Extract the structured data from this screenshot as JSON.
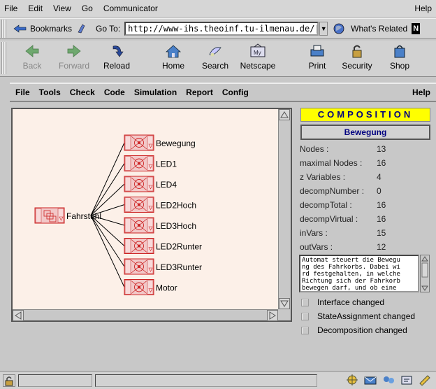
{
  "browser": {
    "menu": [
      "File",
      "Edit",
      "View",
      "Go",
      "Communicator"
    ],
    "help": "Help",
    "bookmarks": "Bookmarks",
    "goto_label": "Go To:",
    "url": "http://www-ihs.theoinf.tu-ilmenau.de/|",
    "whats_related": "What's Related",
    "nav": [
      {
        "label": "Back",
        "icon": "back-arrow-icon",
        "enabled": false
      },
      {
        "label": "Forward",
        "icon": "forward-arrow-icon",
        "enabled": false
      },
      {
        "label": "Reload",
        "icon": "reload-icon",
        "enabled": true
      },
      {
        "label": "Home",
        "icon": "home-icon",
        "enabled": true
      },
      {
        "label": "Search",
        "icon": "search-icon",
        "enabled": true
      },
      {
        "label": "Netscape",
        "icon": "netscape-icon",
        "enabled": true
      },
      {
        "label": "Print",
        "icon": "print-icon",
        "enabled": true
      },
      {
        "label": "Security",
        "icon": "security-lock-icon",
        "enabled": true
      },
      {
        "label": "Shop",
        "icon": "shop-icon",
        "enabled": true
      }
    ]
  },
  "applet": {
    "menu": [
      "File",
      "Tools",
      "Check",
      "Code",
      "Simulation",
      "Report",
      "Config"
    ],
    "help": "Help",
    "diagram": {
      "root": "Fahrstuhl",
      "children": [
        "Bewegung",
        "LED1",
        "LED4",
        "LED2Hoch",
        "LED3Hoch",
        "LED2Runter",
        "LED3Runter",
        "Motor"
      ]
    },
    "panel": {
      "header": "COMPOSITION",
      "selected": "Bewegung",
      "properties": [
        {
          "label": "Nodes :",
          "value": "13"
        },
        {
          "label": "maximal Nodes :",
          "value": "16"
        },
        {
          "label": "z Variables :",
          "value": "4"
        },
        {
          "label": "decompNumber :",
          "value": "0"
        },
        {
          "label": "decompTotal :",
          "value": "16"
        },
        {
          "label": "decompVirtual :",
          "value": "16"
        },
        {
          "label": "inVars :",
          "value": "15"
        },
        {
          "label": "outVars :",
          "value": "12"
        }
      ],
      "description": "Automat steuert die Bewegu\nng des Fahrkorbs. Dabei wi\nrd festgehalten, in welche\nRichtung sich der Fahrkorb\nbewegen darf, und ob eine",
      "checkboxes": [
        "Interface changed",
        "StateAssignment changed",
        "Decomposition changed"
      ]
    }
  }
}
